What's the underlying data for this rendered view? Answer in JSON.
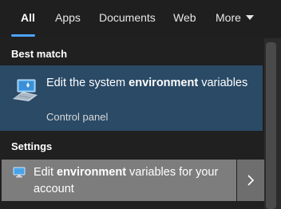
{
  "tabs": [
    {
      "label": "All",
      "active": true
    },
    {
      "label": "Apps"
    },
    {
      "label": "Documents"
    },
    {
      "label": "Web"
    },
    {
      "label": "More"
    }
  ],
  "best_match": {
    "heading": "Best match",
    "title_pre": "Edit the system ",
    "title_bold": "environment",
    "title_post": " variables",
    "subtitle": "Control panel",
    "icon": "system-properties-icon"
  },
  "settings": {
    "heading": "Settings",
    "items": [
      {
        "text_pre": "Edit ",
        "text_bold": "environment",
        "text_post": " variables for your account",
        "icon": "computer-icon"
      }
    ]
  },
  "colors": {
    "accent": "#4ea3ff",
    "best_match_bg": "#2a4a66",
    "hover_bg": "#7d7d7d"
  }
}
